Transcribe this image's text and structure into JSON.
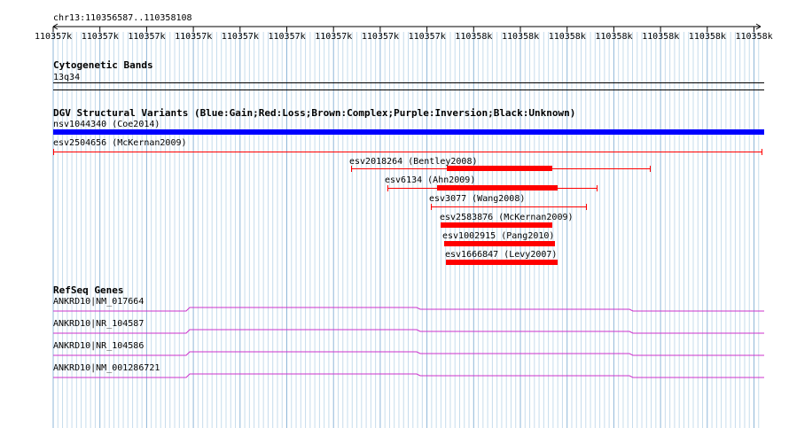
{
  "ruler": {
    "region": "chr13:110356587..110358108",
    "tick_labels": [
      "110357k",
      "110357k",
      "110357k",
      "110357k",
      "110357k",
      "110357k",
      "110357k",
      "110357k",
      "110357k",
      "110358k",
      "110358k",
      "110358k",
      "110358k",
      "110358k",
      "110358k",
      "110358k"
    ]
  },
  "cytoband": {
    "title": "Cytogenetic Bands",
    "band": "13q34"
  },
  "dgv": {
    "title": "DGV Structural Variants (Blue:Gain;Red:Loss;Brown:Complex;Purple:Inversion;Black:Unknown)",
    "colors": {
      "gain": "#0000ff",
      "loss": "#ff0000"
    },
    "features": [
      {
        "label": "nsv1044340 (Coe2014)",
        "type": "gain"
      },
      {
        "label": "esv2504656 (McKernan2009)",
        "type": "loss"
      },
      {
        "label": "esv2018264 (Bentley2008)",
        "type": "loss"
      },
      {
        "label": "esv6134 (Ahn2009)",
        "type": "loss"
      },
      {
        "label": "esv3077 (Wang2008)",
        "type": "loss"
      },
      {
        "label": "esv2583876 (McKernan2009)",
        "type": "loss"
      },
      {
        "label": "esv1002915 (Pang2010)",
        "type": "loss"
      },
      {
        "label": "esv1666847 (Levy2007)",
        "type": "loss"
      }
    ]
  },
  "refseq": {
    "title": "RefSeq Genes",
    "color": "#cc33cc",
    "genes": [
      {
        "label": "ANKRD10|NM_017664"
      },
      {
        "label": "ANKRD10|NR_104587"
      },
      {
        "label": "ANKRD10|NR_104586"
      },
      {
        "label": "ANKRD10|NM_001286721"
      }
    ]
  }
}
